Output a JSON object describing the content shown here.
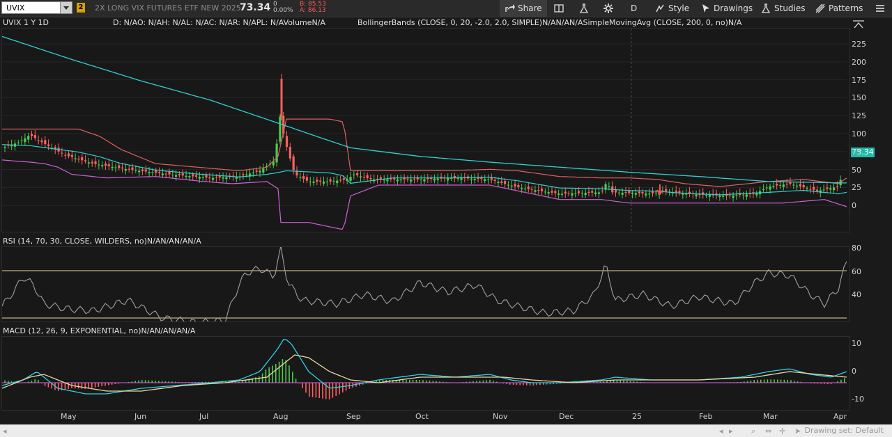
{
  "toolbar": {
    "symbol": "UVIX",
    "link_badge": "2",
    "description": "2X LONG VIX FUTURES ETF NEW 2025",
    "last_price": "73.34",
    "change": "0",
    "change_pct": "0.00%",
    "bid": "B: 85.53",
    "ask": "A: 86.13",
    "share_label": "Share",
    "aggregation": "D",
    "style_label": "Style",
    "drawings_label": "Drawings",
    "studies_label": "Studies",
    "patterns_label": "Patterns"
  },
  "price_header": {
    "title": "UVIX 1 Y 1D",
    "ohlc": "D: N/AO: N/AH: N/AL: N/AC: N/AR: N/APL: N/AVolumeN/A",
    "studies": "BollingerBands (CLOSE, 0, 20, -2.0, 2.0, SIMPLE)N/AN/AN/ASimpleMovingAvg (CLOSE, 200, 0, no)N/A"
  },
  "rsi_header": "RSI (14, 70, 30, CLOSE, WILDERS, no)N/AN/AN/AN/A",
  "macd_header": "MACD (12, 26, 9, EXPONENTIAL, no)N/AN/AN/AN/A",
  "price_axis": [
    "225",
    "200",
    "175",
    "150",
    "125",
    "100",
    "75",
    "50",
    "25",
    "0"
  ],
  "rsi_axis": [
    "80",
    "60",
    "40"
  ],
  "macd_axis": [
    "10",
    "0",
    "-10"
  ],
  "time_axis": [
    "May",
    "Jun",
    "Jul",
    "Aug",
    "Sep",
    "Oct",
    "Nov",
    "Dec",
    "25",
    "Feb",
    "Mar",
    "Apr"
  ],
  "last_price_tag": "73.34",
  "status_bar": {
    "drawing_set": "Drawing set: Default"
  },
  "colors": {
    "sma": "#2fd0d0",
    "bb_upper": "#e06060",
    "bb_lower": "#d060d8",
    "bb_mid": "#2fd0d0",
    "up_candle": "#4ecb4e",
    "down_candle": "#ff6060",
    "rsi_line": "#a0a0a0",
    "rsi_levels": "#e8d8a0",
    "macd_line": "#2fd0e8",
    "macd_signal": "#e8d8a0",
    "macd_zero": "#e060e0"
  },
  "chart_data": {
    "type": "line",
    "x": [
      "May",
      "Jun",
      "Jul",
      "Aug",
      "Sep",
      "Oct",
      "Nov",
      "Dec",
      "25",
      "Feb",
      "Mar",
      "Apr"
    ],
    "ylim": [
      -20,
      240
    ],
    "series": [
      {
        "values": [
          73,
          40,
          35,
          50,
          48,
          40,
          30,
          12,
          15,
          12,
          35,
          73
        ]
      },
      {
        "values": [
          225,
          185,
          155,
          120,
          75,
          65,
          58,
          48,
          40,
          35,
          30,
          32
        ]
      }
    ]
  }
}
